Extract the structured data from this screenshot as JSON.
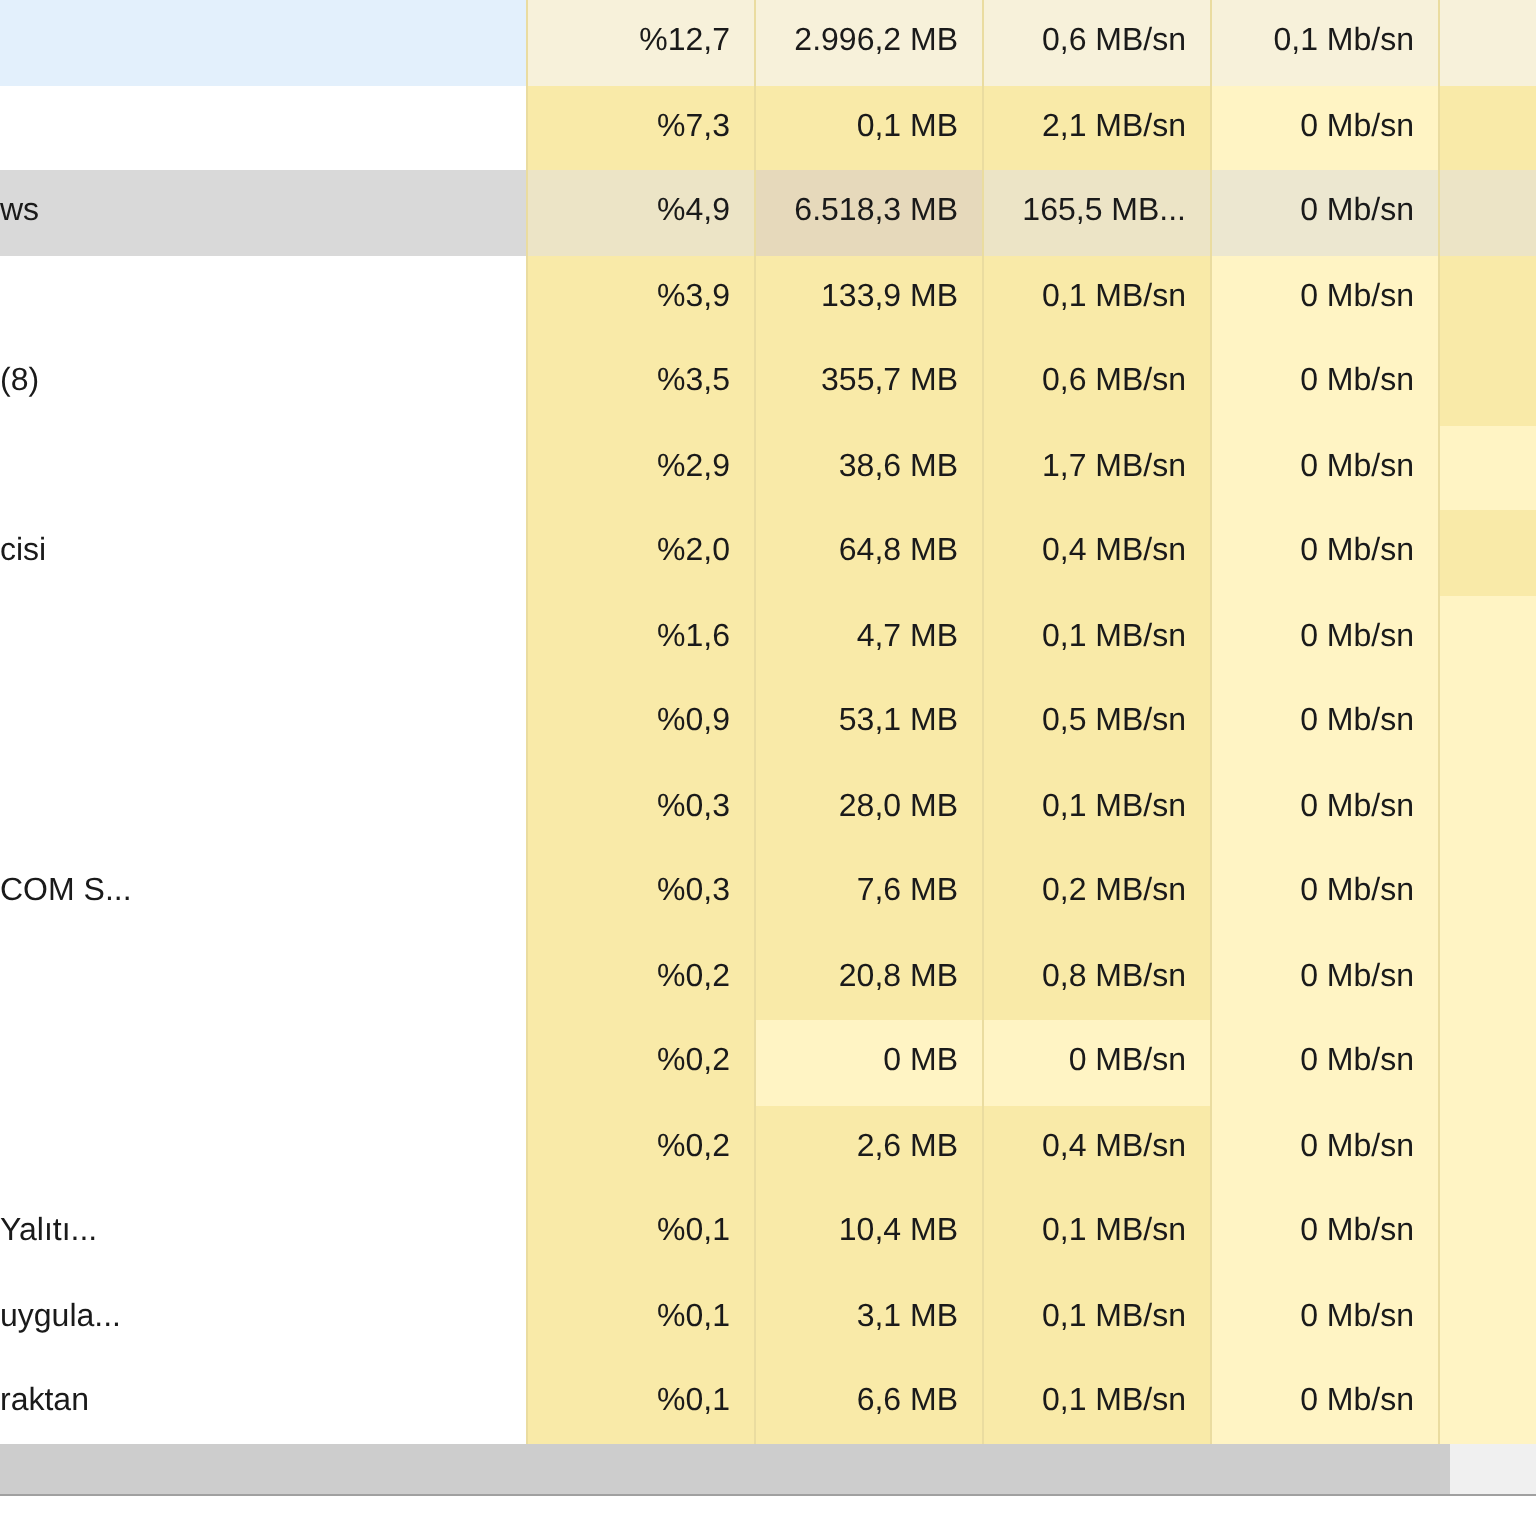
{
  "rows": [
    {
      "selected": true,
      "hover": false,
      "cells": [
        {
          "text": "%12,7",
          "color": "#f7f1da"
        },
        {
          "text": "2.996,2 MB",
          "color": "#f7f1da"
        },
        {
          "text": "0,6 MB/sn",
          "color": "#f7f1da"
        },
        {
          "text": "0,1 Mb/sn",
          "color": "#f7f1da"
        },
        {
          "color": "#f7f1da"
        }
      ]
    },
    {
      "selected": false,
      "hover": false,
      "cells": [
        {
          "text": "%7,3",
          "color": "#f9eaa8"
        },
        {
          "text": "0,1 MB",
          "color": "#f9eaa8"
        },
        {
          "text": "2,1 MB/sn",
          "color": "#f9eaa8"
        },
        {
          "text": "0 Mb/sn",
          "color": "#fff4c4"
        },
        {
          "color": "#f9eaa8"
        }
      ]
    },
    {
      "name": "ws",
      "selected": false,
      "hover": true,
      "cells": [
        {
          "text": "%4,9",
          "color": "#ece4c6"
        },
        {
          "text": "6.518,3 MB",
          "color": "#e6d9bb"
        },
        {
          "text": "165,5 MB...",
          "color": "#ece4c6"
        },
        {
          "text": "0 Mb/sn",
          "color": "#ece7d0"
        },
        {
          "color": "#ece4c6"
        }
      ]
    },
    {
      "selected": false,
      "hover": false,
      "cells": [
        {
          "text": "%3,9",
          "color": "#f9eaa8"
        },
        {
          "text": "133,9 MB",
          "color": "#f9eaa8"
        },
        {
          "text": "0,1 MB/sn",
          "color": "#f9eaa8"
        },
        {
          "text": "0 Mb/sn",
          "color": "#fff4c4"
        },
        {
          "color": "#f9eaa8"
        }
      ]
    },
    {
      "name": "(8)",
      "selected": false,
      "hover": false,
      "cells": [
        {
          "text": "%3,5",
          "color": "#f9eaa8"
        },
        {
          "text": "355,7 MB",
          "color": "#f9eaa8"
        },
        {
          "text": "0,6 MB/sn",
          "color": "#f9eaa8"
        },
        {
          "text": "0 Mb/sn",
          "color": "#fff4c4"
        },
        {
          "color": "#f9eaa8"
        }
      ]
    },
    {
      "selected": false,
      "hover": false,
      "cells": [
        {
          "text": "%2,9",
          "color": "#f9eaa8"
        },
        {
          "text": "38,6 MB",
          "color": "#f9eaa8"
        },
        {
          "text": "1,7 MB/sn",
          "color": "#f9eaa8"
        },
        {
          "text": "0 Mb/sn",
          "color": "#fff4c4"
        },
        {
          "color": "#fff4c4"
        }
      ]
    },
    {
      "name": "cisi",
      "selected": false,
      "hover": false,
      "cells": [
        {
          "text": "%2,0",
          "color": "#f9eaa8"
        },
        {
          "text": "64,8 MB",
          "color": "#f9eaa8"
        },
        {
          "text": "0,4 MB/sn",
          "color": "#f9eaa8"
        },
        {
          "text": "0 Mb/sn",
          "color": "#fff4c4"
        },
        {
          "color": "#f9eaa8"
        }
      ]
    },
    {
      "selected": false,
      "hover": false,
      "cells": [
        {
          "text": "%1,6",
          "color": "#f9eaa8"
        },
        {
          "text": "4,7 MB",
          "color": "#f9eaa8"
        },
        {
          "text": "0,1 MB/sn",
          "color": "#f9eaa8"
        },
        {
          "text": "0 Mb/sn",
          "color": "#fff4c4"
        },
        {
          "color": "#fff4c4"
        }
      ]
    },
    {
      "selected": false,
      "hover": false,
      "cells": [
        {
          "text": "%0,9",
          "color": "#f9eaa8"
        },
        {
          "text": "53,1 MB",
          "color": "#f9eaa8"
        },
        {
          "text": "0,5 MB/sn",
          "color": "#f9eaa8"
        },
        {
          "text": "0 Mb/sn",
          "color": "#fff4c4"
        },
        {
          "color": "#fff4c4"
        }
      ]
    },
    {
      "selected": false,
      "hover": false,
      "cells": [
        {
          "text": "%0,3",
          "color": "#f9eaa8"
        },
        {
          "text": "28,0 MB",
          "color": "#f9eaa8"
        },
        {
          "text": "0,1 MB/sn",
          "color": "#f9eaa8"
        },
        {
          "text": "0 Mb/sn",
          "color": "#fff4c4"
        },
        {
          "color": "#fff4c4"
        }
      ]
    },
    {
      "name": "COM S...",
      "selected": false,
      "hover": false,
      "cells": [
        {
          "text": "%0,3",
          "color": "#f9eaa8"
        },
        {
          "text": "7,6 MB",
          "color": "#f9eaa8"
        },
        {
          "text": "0,2 MB/sn",
          "color": "#f9eaa8"
        },
        {
          "text": "0 Mb/sn",
          "color": "#fff4c4"
        },
        {
          "color": "#fff4c4"
        }
      ]
    },
    {
      "selected": false,
      "hover": false,
      "cells": [
        {
          "text": "%0,2",
          "color": "#f9eaa8"
        },
        {
          "text": "20,8 MB",
          "color": "#f9eaa8"
        },
        {
          "text": "0,8 MB/sn",
          "color": "#f9eaa8"
        },
        {
          "text": "0 Mb/sn",
          "color": "#fff4c4"
        },
        {
          "color": "#fff4c4"
        }
      ]
    },
    {
      "selected": false,
      "hover": false,
      "cells": [
        {
          "text": "%0,2",
          "color": "#f9eaa8"
        },
        {
          "text": "0 MB",
          "color": "#fff4c4"
        },
        {
          "text": "0 MB/sn",
          "color": "#fff4c4"
        },
        {
          "text": "0 Mb/sn",
          "color": "#fff4c4"
        },
        {
          "color": "#fff4c4"
        }
      ]
    },
    {
      "selected": false,
      "hover": false,
      "cells": [
        {
          "text": "%0,2",
          "color": "#f9eaa8"
        },
        {
          "text": "2,6 MB",
          "color": "#f9eaa8"
        },
        {
          "text": "0,4 MB/sn",
          "color": "#f9eaa8"
        },
        {
          "text": "0 Mb/sn",
          "color": "#fff4c4"
        },
        {
          "color": "#fff4c4"
        }
      ]
    },
    {
      "name": "Yalıtı...",
      "selected": false,
      "hover": false,
      "cells": [
        {
          "text": "%0,1",
          "color": "#f9eaa8"
        },
        {
          "text": "10,4 MB",
          "color": "#f9eaa8"
        },
        {
          "text": "0,1 MB/sn",
          "color": "#f9eaa8"
        },
        {
          "text": "0 Mb/sn",
          "color": "#fff4c4"
        },
        {
          "color": "#fff4c4"
        }
      ]
    },
    {
      "name": "uygula...",
      "selected": false,
      "hover": false,
      "cells": [
        {
          "text": "%0,1",
          "color": "#f9eaa8"
        },
        {
          "text": "3,1 MB",
          "color": "#f9eaa8"
        },
        {
          "text": "0,1 MB/sn",
          "color": "#f9eaa8"
        },
        {
          "text": "0 Mb/sn",
          "color": "#fff4c4"
        },
        {
          "color": "#fff4c4"
        }
      ]
    },
    {
      "name": "raktan",
      "selected": false,
      "hover": false,
      "cells": [
        {
          "text": "%0,1",
          "color": "#f9eaa8"
        },
        {
          "text": "6,6 MB",
          "color": "#f9eaa8"
        },
        {
          "text": "0,1 MB/sn",
          "color": "#f9eaa8"
        },
        {
          "text": "0 Mb/sn",
          "color": "#fff4c4"
        },
        {
          "color": "#fff4c4"
        }
      ]
    }
  ]
}
